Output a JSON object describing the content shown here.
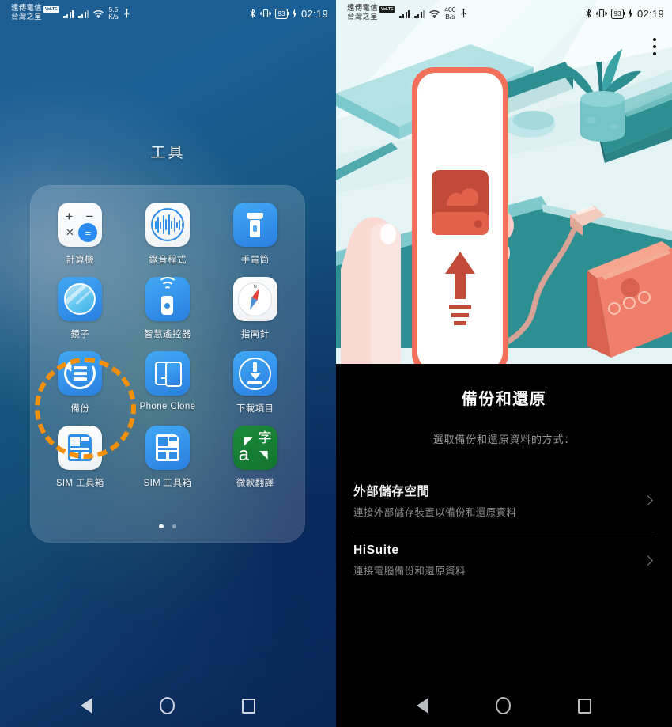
{
  "status_bar": {
    "carrier_line1": "遠傳電信",
    "carrier_badge": "VoLTE",
    "carrier_line2": "台灣之星",
    "speed_left_value": "5.5",
    "speed_left_unit": "K/s",
    "speed_right_value": "400",
    "speed_right_unit": "B/s",
    "battery_percent": "93",
    "clock": "02:19"
  },
  "home": {
    "folder_title": "工具",
    "apps": [
      {
        "label": "計算機",
        "icon": "calculator-icon"
      },
      {
        "label": "錄音程式",
        "icon": "sound-recorder-icon"
      },
      {
        "label": "手電筒",
        "icon": "flashlight-icon"
      },
      {
        "label": "鏡子",
        "icon": "mirror-icon"
      },
      {
        "label": "智慧遙控器",
        "icon": "smart-remote-icon"
      },
      {
        "label": "指南針",
        "icon": "compass-icon"
      },
      {
        "label": "備份",
        "icon": "backup-icon"
      },
      {
        "label": "Phone Clone",
        "icon": "phone-clone-icon"
      },
      {
        "label": "下載項目",
        "icon": "downloads-icon"
      },
      {
        "label": "SIM 工具箱",
        "icon": "sim-toolkit-icon"
      },
      {
        "label": "SIM 工具箱",
        "icon": "sim-toolkit-icon"
      },
      {
        "label": "微軟翻譯",
        "icon": "microsoft-translator-icon"
      }
    ],
    "highlighted_app": "備份",
    "page_count": 2,
    "active_page": 1
  },
  "backup_screen": {
    "title": "備份和還原",
    "subtitle": "選取備份和還原資料的方式：",
    "options": [
      {
        "title": "外部儲存空間",
        "subtitle": "連接外部儲存裝置以備份和還原資料"
      },
      {
        "title": "HiSuite",
        "subtitle": "連接電腦備份和還原資料"
      }
    ]
  },
  "colors": {
    "highlight_ring": "#f5900a",
    "icon_blue": "#2f8ee6",
    "translator_green": "#1b8a3a",
    "illustration_coral": "#f2705a",
    "illustration_teal": "#2e8f92"
  },
  "nav": {
    "back": "back-button",
    "home": "home-button",
    "recents": "recents-button"
  }
}
